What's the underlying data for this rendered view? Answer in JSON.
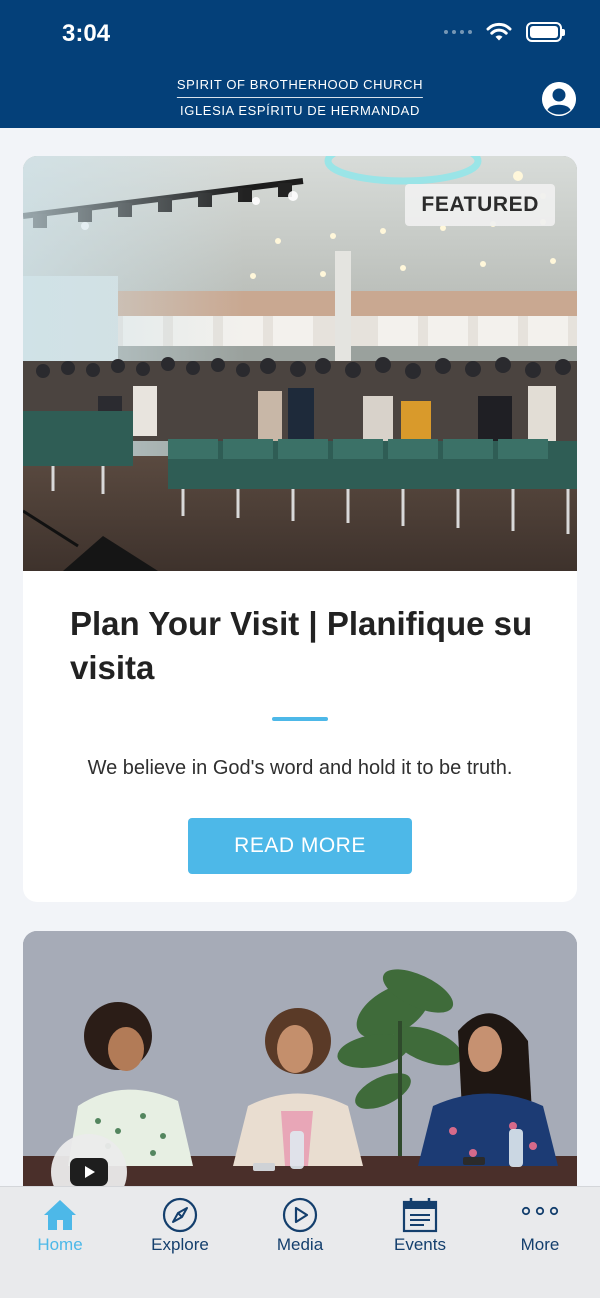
{
  "status_bar": {
    "time": "3:04"
  },
  "header": {
    "brand_line1": "SPIRIT OF BROTHERHOOD CHURCH",
    "brand_line2": "IGLESIA ESPÍRITU DE HERMANDAD",
    "profile_icon": "person-circle-icon",
    "bg_color": "#044079"
  },
  "featured_card": {
    "badge": "FEATURED",
    "title": "Plan Your Visit | Planifique su visita",
    "description": "We believe in God's word and hold it to be truth.",
    "button_label": "READ MORE",
    "accent_color": "#4db8e8"
  },
  "video_card": {
    "play_icon": "youtube-play-icon"
  },
  "tabbar": {
    "tabs": [
      {
        "label": "Home",
        "icon": "home-icon",
        "active": true
      },
      {
        "label": "Explore",
        "icon": "compass-icon",
        "active": false
      },
      {
        "label": "Media",
        "icon": "play-circle-icon",
        "active": false
      },
      {
        "label": "Events",
        "icon": "calendar-icon",
        "active": false
      },
      {
        "label": "More",
        "icon": "more-dots-icon",
        "active": false
      }
    ]
  }
}
